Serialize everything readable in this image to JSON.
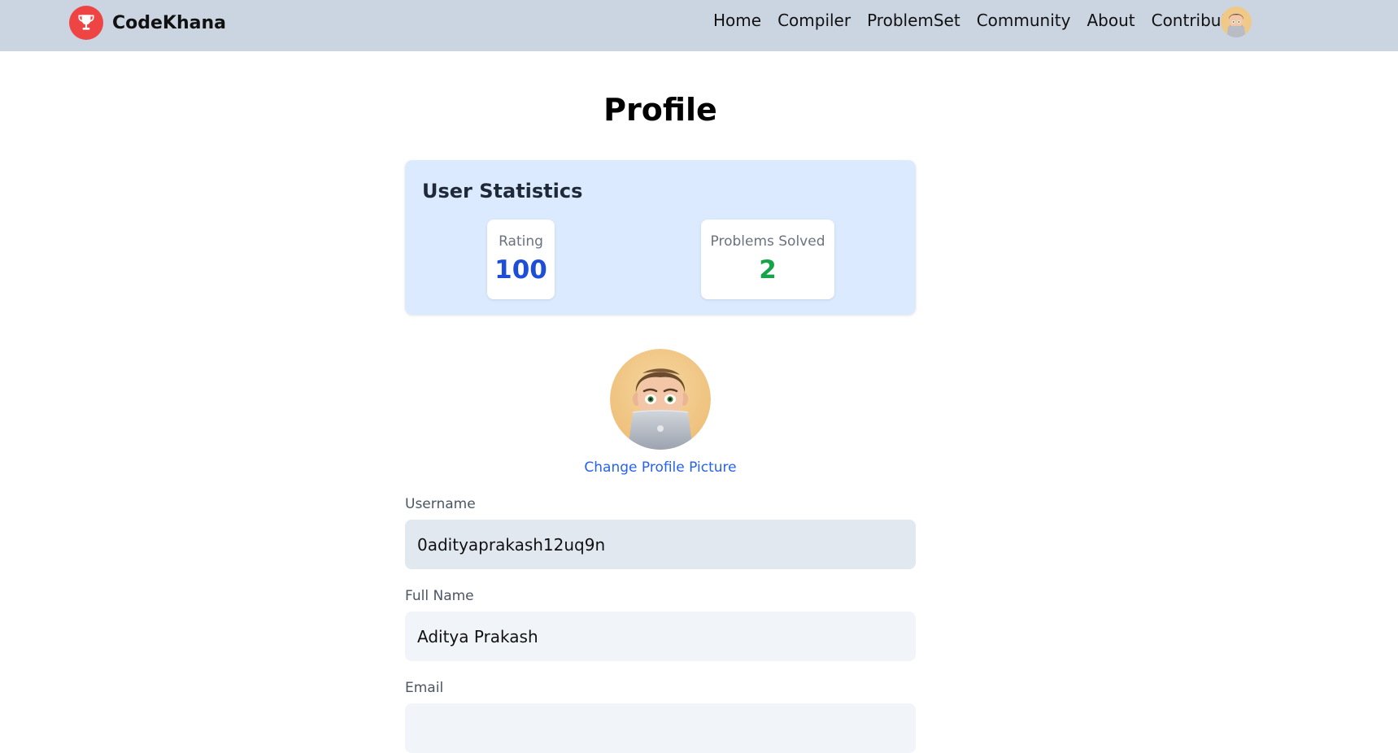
{
  "navbar": {
    "brand": "CodeKhana",
    "links": [
      "Home",
      "Compiler",
      "ProblemSet",
      "Community",
      "About",
      "Contribute"
    ]
  },
  "page": {
    "title": "Profile"
  },
  "stats": {
    "heading": "User Statistics",
    "rating_label": "Rating",
    "rating_value": "100",
    "solved_label": "Problems Solved",
    "solved_value": "2"
  },
  "profile": {
    "change_picture": "Change Profile Picture"
  },
  "form": {
    "username_label": "Username",
    "username_value": "0adityaprakash12uq9n",
    "fullname_label": "Full Name",
    "fullname_value": "Aditya Prakash",
    "email_label": "Email",
    "email_value": ""
  },
  "icons": {
    "brand_logo": "trophy-icon",
    "avatar": "memoji-avatar"
  },
  "colors": {
    "navbar_bg": "#cbd5e1",
    "brand_red": "#ef4444",
    "stats_bg": "#dbeafe",
    "rating_blue": "#1d4ed8",
    "solved_green": "#16a34a",
    "link_blue": "#2563eb"
  }
}
